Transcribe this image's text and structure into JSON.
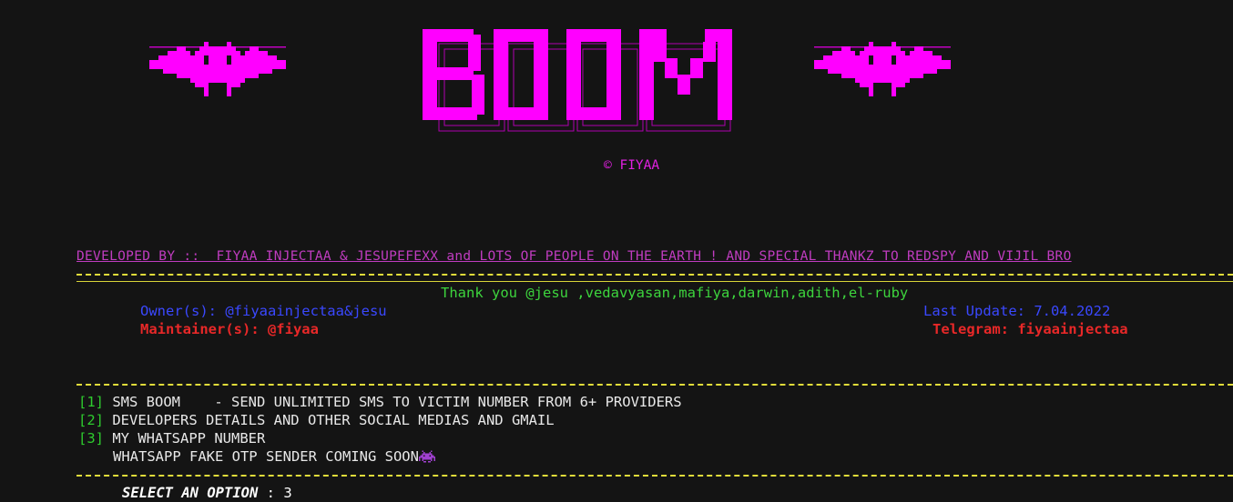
{
  "banner": {
    "word": "BOOM",
    "copyright": "© FIYAA",
    "accent_color": "#ff00ff"
  },
  "developed_by": "DEVELOPED BY ::  FIYAA INJECTAA & JESUPEFEXX and LOTS OF PEOPLE ON THE EARTH ! AND SPECIAL THANKZ TO REDSPY AND VIJIL BRO",
  "info": {
    "thanks": "Thank you @jesu ,vedavyasan,mafiya,darwin,adith,el-ruby",
    "owner": "Owner(s): @fiyaainjectaa&jesu",
    "last_update": "Last Update: 7.04.2022",
    "maintainer": "Maintainer(s): @fiyaa",
    "telegram": "Telegram: fiyaainjectaa"
  },
  "menu": [
    {
      "num": "[1]",
      "text": "SMS BOOM    - SEND UNLIMITED SMS TO VICTIM NUMBER FROM 6+ PROVIDERS"
    },
    {
      "num": "[2]",
      "text": "DEVELOPERS DETAILS AND OTHER SOCIAL MEDIAS AND GMAIL"
    },
    {
      "num": "[3]",
      "text": "MY WHATSAPP NUMBER"
    },
    {
      "num": "",
      "text": "WHATSAPP FAKE OTP SENDER COMING SOON"
    }
  ],
  "prompt": {
    "label": "SELECT AN OPTION",
    "separator": " : ",
    "value": "3"
  },
  "icons": {
    "bats": "bat-icon",
    "invader": "space-invader-icon"
  }
}
